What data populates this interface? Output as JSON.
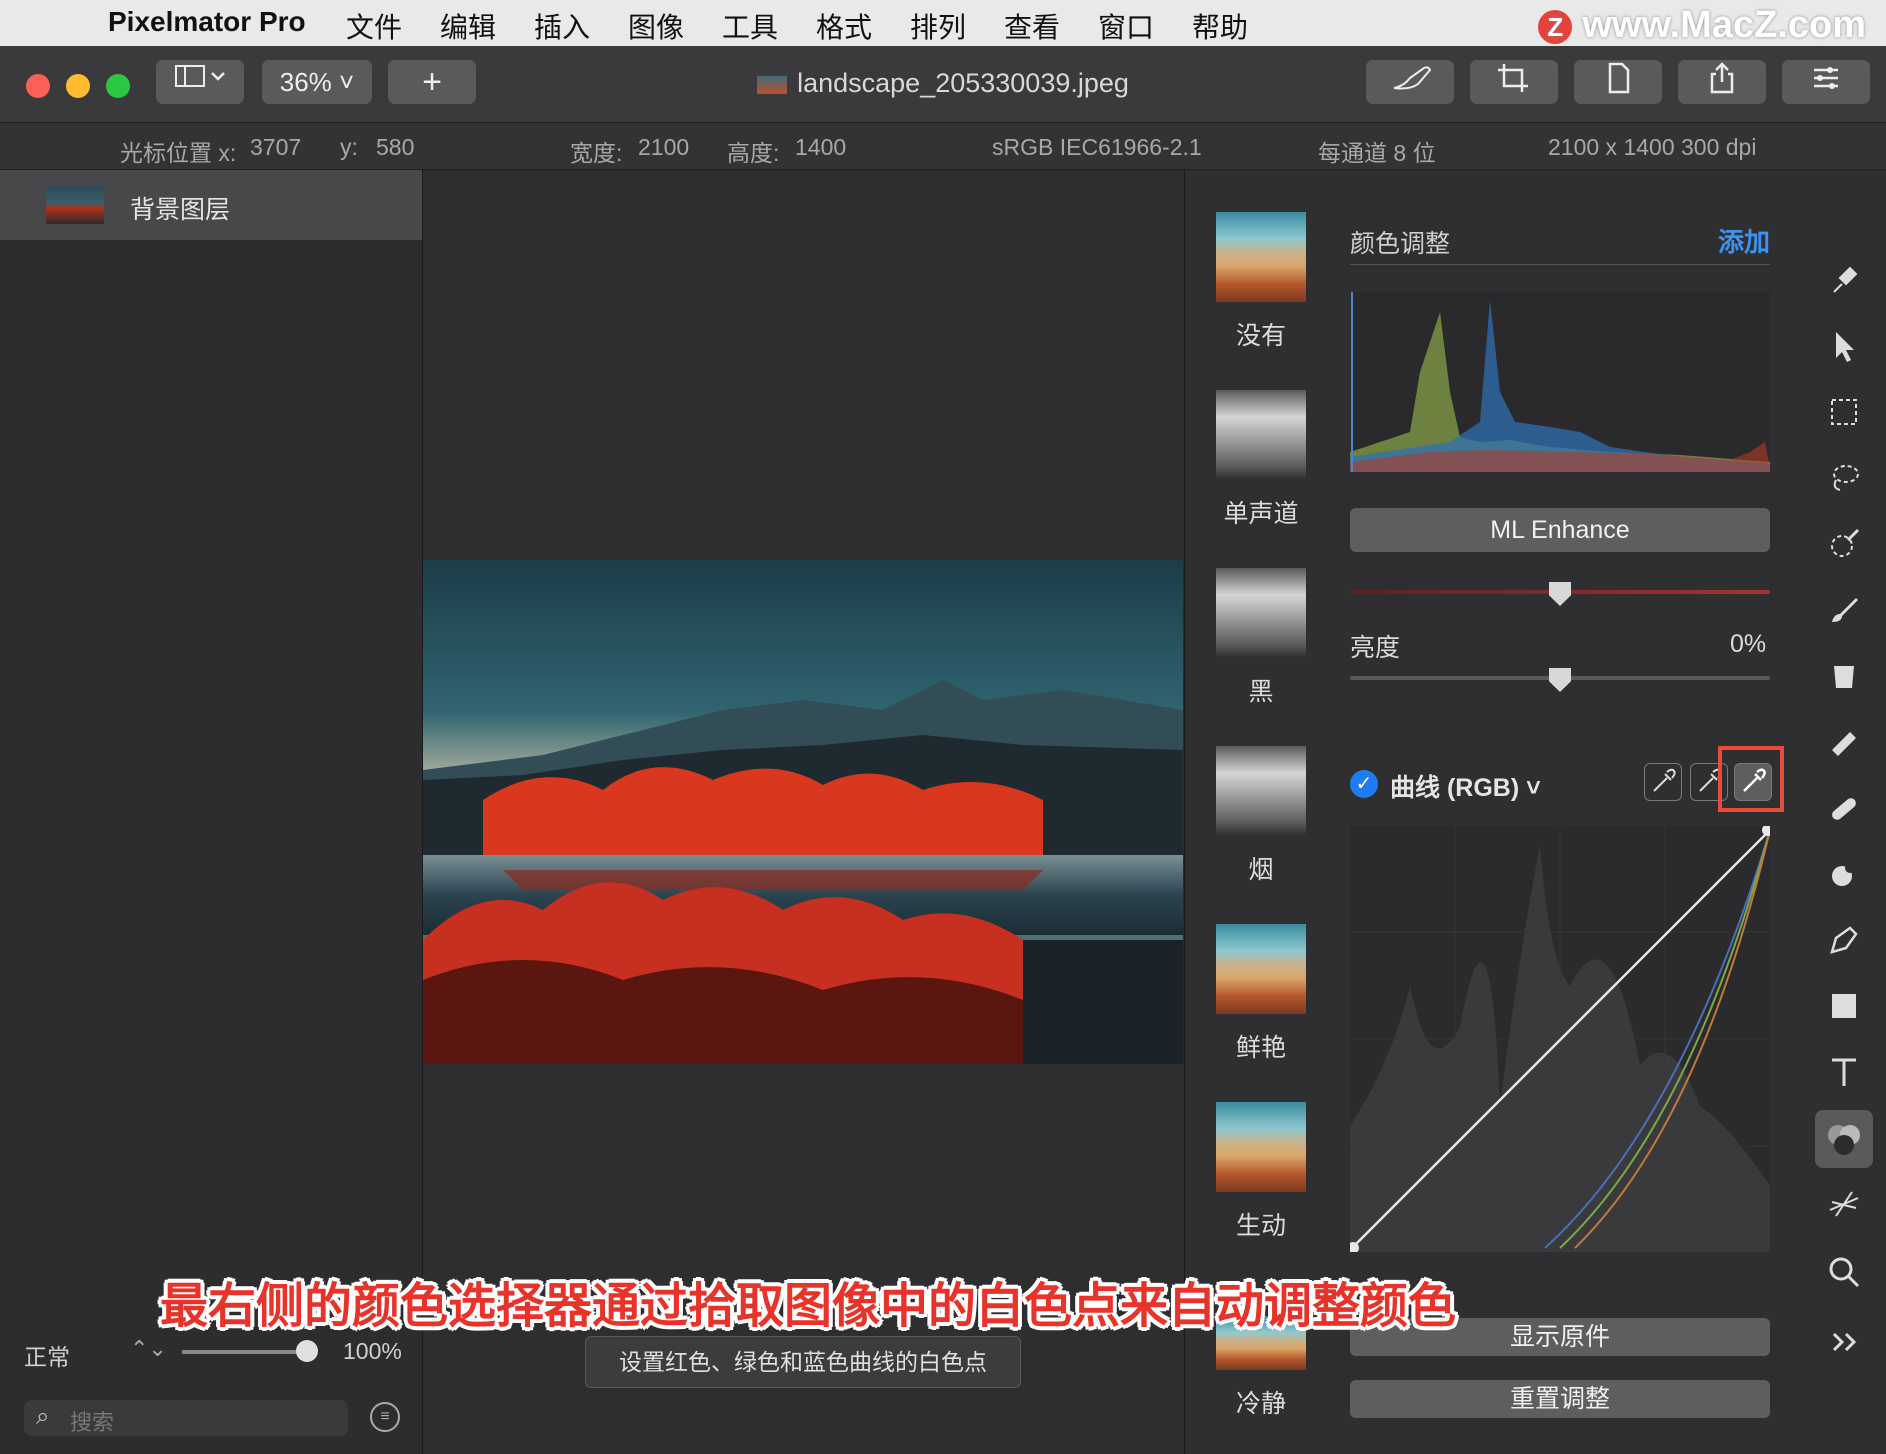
{
  "menubar": {
    "app_name": "Pixelmator Pro",
    "items": [
      "文件",
      "编辑",
      "插入",
      "图像",
      "工具",
      "格式",
      "排列",
      "查看",
      "窗口",
      "帮助"
    ],
    "watermark": "www.MacZ.com",
    "watermark_logo": "Z"
  },
  "toolbar": {
    "zoom": "36%",
    "add_label": "+",
    "document_title": "landscape_205330039.jpeg"
  },
  "infobar": {
    "cursor_x_label": "光标位置 x:",
    "cursor_x": "3707",
    "cursor_y_label": "y:",
    "cursor_y": "580",
    "width_label": "宽度:",
    "width": "2100",
    "height_label": "高度:",
    "height": "1400",
    "color_profile": "sRGB IEC61966-2.1",
    "bit_depth": "每通道 8 位",
    "resolution": "2100 x 1400 300 dpi"
  },
  "layers": {
    "items": [
      {
        "name": "背景图层"
      }
    ],
    "blend_mode": "正常",
    "opacity": "100%",
    "opacity_fraction": 1.0,
    "search_placeholder": "搜索"
  },
  "presets": [
    {
      "label": "没有",
      "style": "color"
    },
    {
      "label": "单声道",
      "style": "gray"
    },
    {
      "label": "黑",
      "style": "gray"
    },
    {
      "label": "烟",
      "style": "gray"
    },
    {
      "label": "鲜艳",
      "style": "color"
    },
    {
      "label": "生动",
      "style": "color"
    },
    {
      "label": "冷静",
      "style": "color"
    }
  ],
  "adjustments": {
    "section_title": "颜色调整",
    "add_label": "添加",
    "ml_enhance": "ML Enhance",
    "saturation_fraction": 0.5,
    "brightness_label": "亮度",
    "brightness_value": "0%",
    "brightness_fraction": 0.5,
    "curves_label": "曲线 (RGB)",
    "show_original": "显示原件",
    "reset": "重置调整"
  },
  "tools": [
    "paint-style-icon",
    "arrange-icon",
    "rect-select-icon",
    "lasso-icon",
    "magic-wand-icon",
    "paint-icon",
    "fill-icon",
    "erase-icon",
    "retouch-icon",
    "distort-icon",
    "pen-icon",
    "shape-icon",
    "type-icon",
    "color-adjust-icon",
    "effects-icon",
    "zoom-icon",
    "more-icon"
  ],
  "caption": "最右侧的颜色选择器通过拾取图像中的白色点来自动调整颜色",
  "tooltip": "设置红色、绿色和蓝色曲线的白色点",
  "colors": {
    "accent": "#1d7cf2",
    "highlight": "#e84a3c",
    "caption": "#e8332b"
  }
}
